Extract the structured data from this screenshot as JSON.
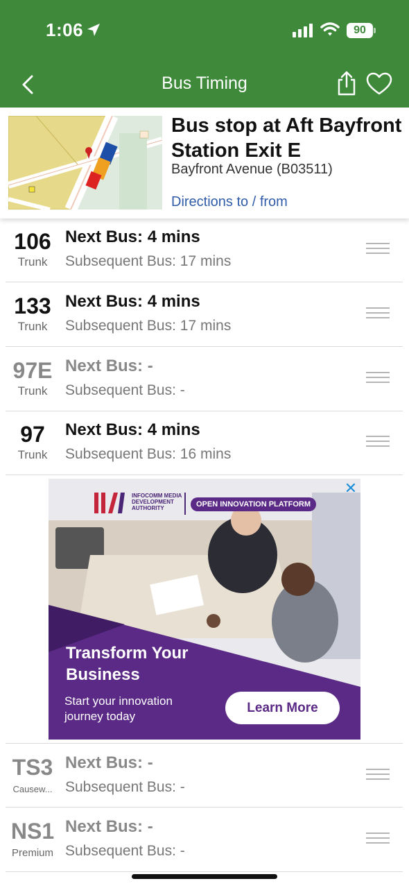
{
  "status_bar": {
    "time": "1:06",
    "battery": "90"
  },
  "header": {
    "title": "Bus Timing"
  },
  "stop": {
    "name": "Bus stop at Aft Bayfront Station Exit E",
    "road": "Bayfront Avenue (B03511)",
    "directions_link": "Directions to / from"
  },
  "services": [
    {
      "number": "106",
      "type": "Trunk",
      "next": "Next Bus: 4 mins",
      "subsequent": "Subsequent Bus: 17 mins",
      "active": true
    },
    {
      "number": "133",
      "type": "Trunk",
      "next": "Next Bus: 4 mins",
      "subsequent": "Subsequent Bus: 17 mins",
      "active": true
    },
    {
      "number": "97E",
      "type": "Trunk",
      "next": "Next Bus: -",
      "subsequent": "Subsequent Bus: -",
      "active": false
    },
    {
      "number": "97",
      "type": "Trunk",
      "next": "Next Bus: 4 mins",
      "subsequent": "Subsequent Bus: 16 mins",
      "active": true
    },
    {
      "number": "TS3",
      "type": "Causew...",
      "next": "Next Bus: -",
      "subsequent": "Subsequent Bus: -",
      "active": false
    },
    {
      "number": "NS1",
      "type": "Premium",
      "next": "Next Bus: -",
      "subsequent": "Subsequent Bus: -",
      "active": false
    }
  ],
  "ad": {
    "logo_text": "INFOCOMM MEDIA DEVELOPMENT AUTHORITY",
    "pill": "OPEN INNOVATION PLATFORM",
    "headline": "Transform Your Business",
    "subtext": "Start your innovation journey today",
    "cta": "Learn More"
  },
  "colors": {
    "header_green": "#3e8a3a",
    "link_blue": "#2f5ba8",
    "ad_purple": "#5b2a86"
  },
  "icons": [
    "location-arrow-icon",
    "signal-icon",
    "wifi-icon",
    "battery-icon",
    "back-chevron-icon",
    "share-icon",
    "heart-icon",
    "drag-handle-icon",
    "close-icon"
  ]
}
